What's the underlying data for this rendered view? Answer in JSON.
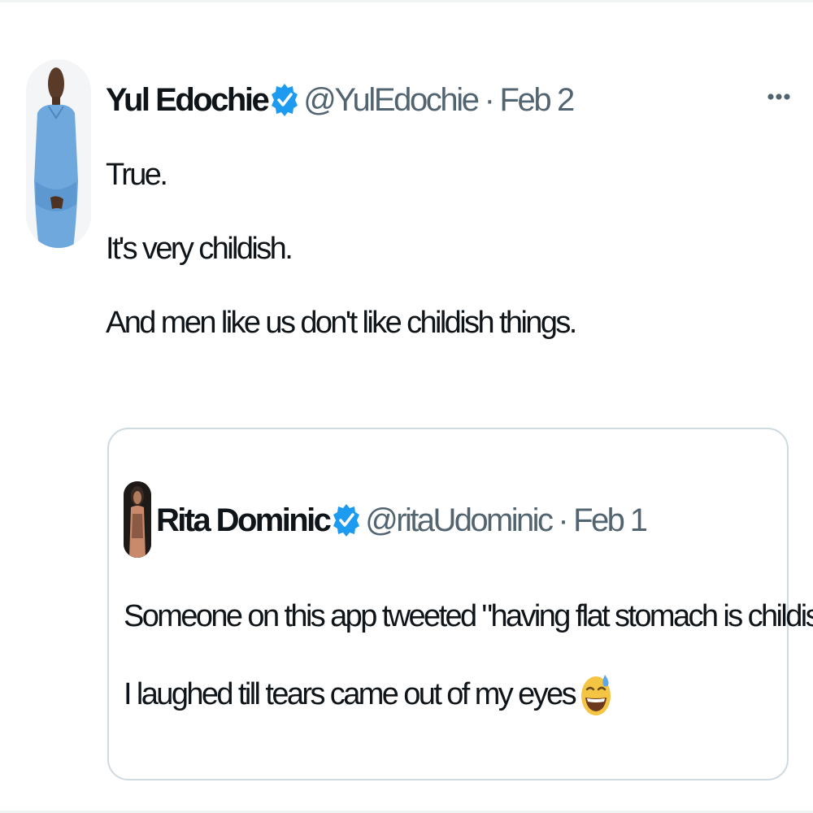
{
  "tweet": {
    "author": {
      "display_name": "Yul Edochie",
      "handle": "@YulEdochie",
      "verified": true
    },
    "separator": "·",
    "date": "Feb 2",
    "more_icon": "more-horizontal-icon",
    "lines": [
      "True.",
      "It's very childish.",
      "And men like us don't like childish things."
    ]
  },
  "quoted_tweet": {
    "author": {
      "display_name": "Rita Dominic",
      "handle": "@ritaUdominic",
      "verified": true
    },
    "separator": "·",
    "date": "Feb 1",
    "lines": [
      "Someone on this app tweeted \"having flat stomach is childish\"",
      "I laughed till tears came out of my eyes"
    ],
    "emoji": "grinning-face-with-sweat-icon"
  },
  "colors": {
    "text_primary": "#0f1419",
    "text_secondary": "#536471",
    "verified_blue": "#1d9bf0",
    "border": "#cfd9de"
  }
}
